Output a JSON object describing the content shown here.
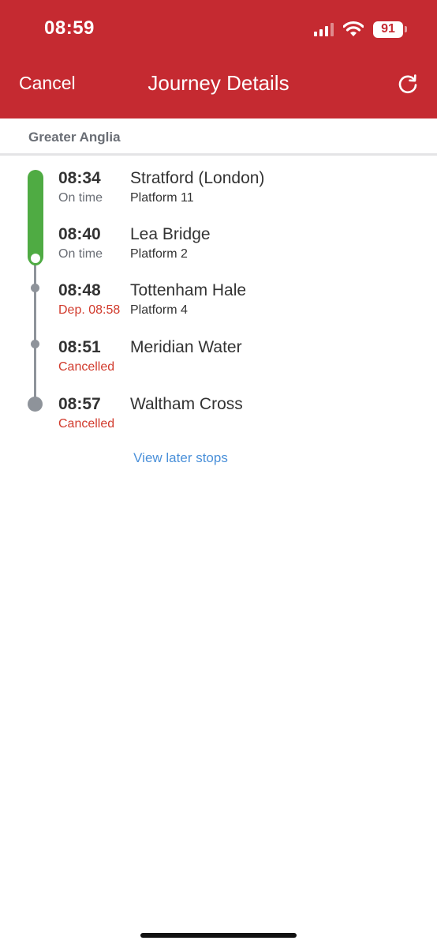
{
  "status_bar": {
    "time": "08:59",
    "battery": "91"
  },
  "nav": {
    "cancel_label": "Cancel",
    "title": "Journey Details"
  },
  "operator": "Greater Anglia",
  "stops": [
    {
      "time": "08:34",
      "status": "On time",
      "status_type": "ok",
      "name": "Stratford (London)",
      "platform": "Platform 11"
    },
    {
      "time": "08:40",
      "status": "On time",
      "status_type": "ok",
      "name": "Lea Bridge",
      "platform": "Platform 2"
    },
    {
      "time": "08:48",
      "status": "Dep. 08:58",
      "status_type": "bad",
      "name": "Tottenham Hale",
      "platform": "Platform 4"
    },
    {
      "time": "08:51",
      "status": "Cancelled",
      "status_type": "bad",
      "name": "Meridian Water",
      "platform": ""
    },
    {
      "time": "08:57",
      "status": "Cancelled",
      "status_type": "bad",
      "name": "Waltham Cross",
      "platform": ""
    }
  ],
  "view_later_label": "View later stops",
  "colors": {
    "header": "#c52a31",
    "progress": "#4fab43",
    "line": "#8e939a",
    "alert": "#d13a2c",
    "link": "#4a90d9"
  }
}
